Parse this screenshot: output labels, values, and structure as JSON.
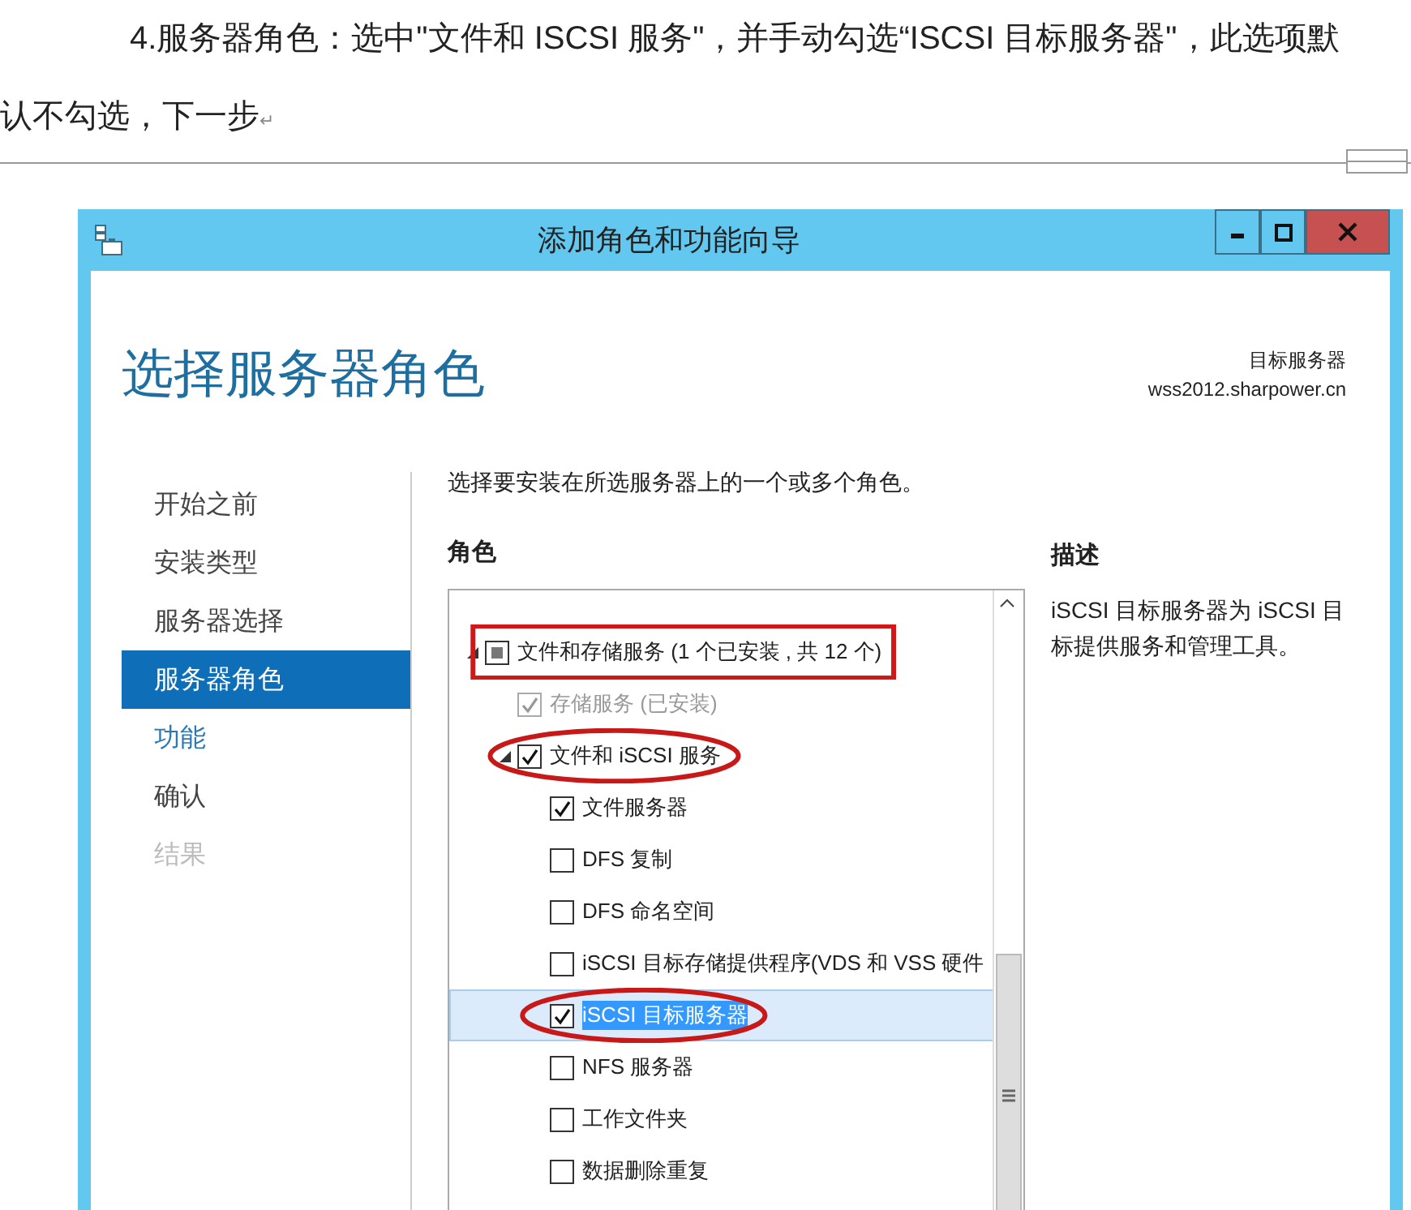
{
  "document": {
    "paragraph": "4.服务器角色：选中\"文件和 ISCSI 服务\"，并手动勾选“ISCSI 目标服务器\"，此选项默认不勾选，下一步",
    "paragraph_mark": "↵"
  },
  "window": {
    "title": "添加角色和功能向导",
    "heading": "选择服务器角色",
    "target_label": "目标服务器",
    "target_server": "wss2012.sharpower.cn"
  },
  "sidebar": {
    "items": [
      {
        "label": "开始之前",
        "selected": false,
        "link": false,
        "disabled": false
      },
      {
        "label": "安装类型",
        "selected": false,
        "link": false,
        "disabled": false
      },
      {
        "label": "服务器选择",
        "selected": false,
        "link": false,
        "disabled": false
      },
      {
        "label": "服务器角色",
        "selected": true,
        "link": false,
        "disabled": false
      },
      {
        "label": "功能",
        "selected": false,
        "link": true,
        "disabled": false
      },
      {
        "label": "确认",
        "selected": false,
        "link": false,
        "disabled": false
      },
      {
        "label": "结果",
        "selected": false,
        "link": false,
        "disabled": true
      }
    ]
  },
  "instruction": "选择要安装在所选服务器上的一个或多个角色。",
  "roles": {
    "heading": "角色",
    "items": [
      {
        "label": "文件和存储服务 (1 个已安装 , 共 12 个)",
        "checked": false,
        "indeterminate": true,
        "disabled": false,
        "selected": false,
        "expanded": true,
        "boxed": true,
        "children": [
          {
            "label": "存储服务 (已安装)",
            "checked": true,
            "disabled": true,
            "selected": false
          },
          {
            "label": "文件和 iSCSI 服务",
            "checked": true,
            "disabled": false,
            "selected": false,
            "expanded": true,
            "circled": true,
            "children": [
              {
                "label": "文件服务器",
                "checked": true,
                "disabled": false,
                "selected": false
              },
              {
                "label": "DFS 复制",
                "checked": false,
                "disabled": false,
                "selected": false
              },
              {
                "label": "DFS 命名空间",
                "checked": false,
                "disabled": false,
                "selected": false
              },
              {
                "label": "iSCSI 目标存储提供程序(VDS 和 VSS 硬件",
                "checked": false,
                "disabled": false,
                "selected": false
              },
              {
                "label": "iSCSI 目标服务器",
                "checked": true,
                "disabled": false,
                "selected": true,
                "circled": true
              },
              {
                "label": "NFS 服务器",
                "checked": false,
                "disabled": false,
                "selected": false
              },
              {
                "label": "工作文件夹",
                "checked": false,
                "disabled": false,
                "selected": false
              },
              {
                "label": "数据删除重复",
                "checked": false,
                "disabled": false,
                "selected": false
              }
            ]
          }
        ]
      }
    ]
  },
  "description": {
    "heading": "描述",
    "text": "iSCSI 目标服务器为 iSCSI 目标提供服务和管理工具。"
  }
}
